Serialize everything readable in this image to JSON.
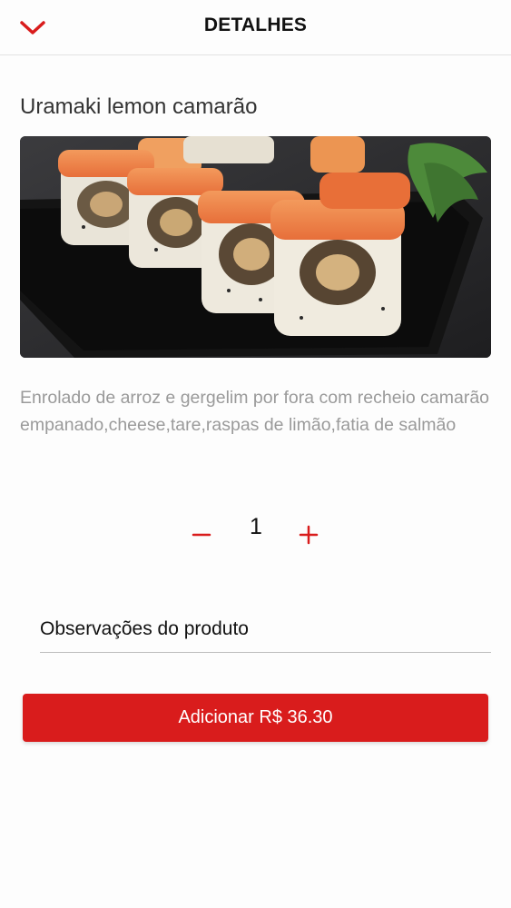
{
  "header": {
    "title": "DETALHES",
    "back_icon": "chevron-down-icon",
    "accent_color": "#d91c1c"
  },
  "product": {
    "name": "Uramaki lemon camarão",
    "image_icon": "sushi-photo",
    "description": "Enrolado de arroz e gergelim por fora com recheio camarão empanado,cheese,tare,raspas de limão,fatia de salmão"
  },
  "quantity": {
    "value": "1",
    "minus_icon": "minus-icon",
    "plus_icon": "plus-icon"
  },
  "observations": {
    "placeholder": "Observações do produto",
    "value": ""
  },
  "add_button": {
    "label": "Adicionar R$ 36.30",
    "color": "#d91c1c"
  }
}
